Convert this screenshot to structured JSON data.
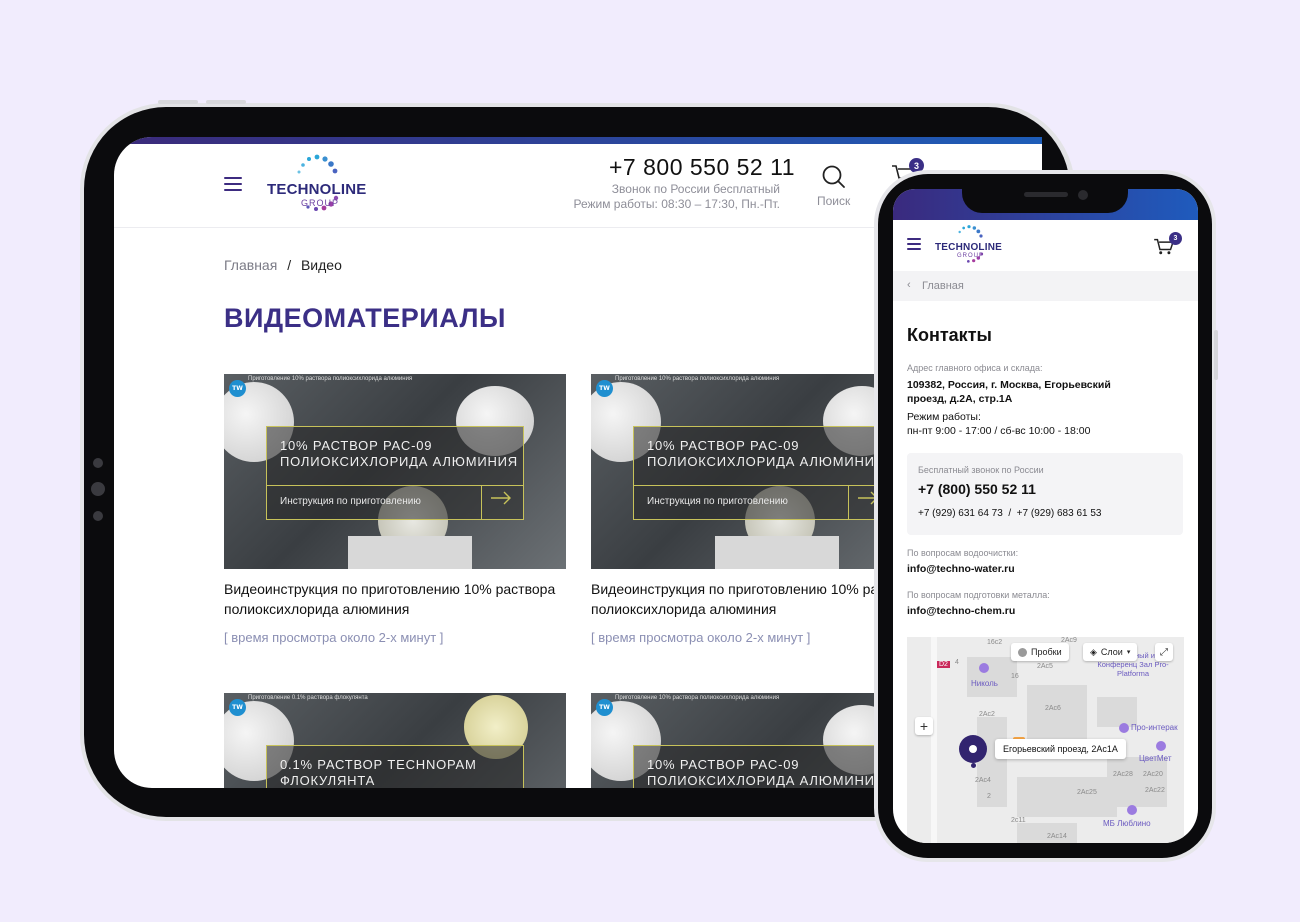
{
  "tablet": {
    "header": {
      "logo": "TECHNOLINE",
      "logo_sub": "GROUP",
      "phone": "+7 800 550 52 11",
      "call_note": "Звонок по России бесплатный",
      "hours": "Режим работы: 08:30 – 17:30, Пн.-Пт.",
      "search_label": "Поиск",
      "cart_count": "3"
    },
    "breadcrumb": {
      "home": "Главная",
      "separator": "/",
      "current": "Видео"
    },
    "page_title": "ВИДЕОМАТЕРИАЛЫ",
    "videos": [
      {
        "overlay_line1": "10% РАСТВОР PAC-09",
        "overlay_line2": "ПОЛИОКСИХЛОРИДА АЛЮМИНИЯ",
        "overlay_sub": "Инструкция по приготовлению",
        "top_caption": "Приготовление 10% раствора полиоксихлорида алюминия",
        "title": "Видеоинструкция по приготовлению 10% раствора полиоксихлорида алюминия",
        "duration": "[ время просмотра около 2-х минут ]"
      },
      {
        "overlay_line1": "10% РАСТВОР PAC-09",
        "overlay_line2": "ПОЛИОКСИХЛОРИДА АЛЮМИНИЯ",
        "overlay_sub": "Инструкция по приготовлению",
        "top_caption": "Приготовление 10% раствора полиоксихлорида алюминия",
        "title": "Видеоинструкция по приготовлению 10% раствора полиоксихлорида алюминия",
        "duration": "[ время просмотра около 2-х минут ]"
      },
      {
        "overlay_line1": "0.1% РАСТВОР TECHNOPAM",
        "overlay_line2": "ФЛОКУЛЯНТА",
        "top_caption": "Приготовление 0.1% раствора флокулянта"
      },
      {
        "overlay_line1": "10% РАСТВОР PAC-09",
        "overlay_line2": "ПОЛИОКСИХЛОРИДА АЛЮМИНИЯ",
        "top_caption": "Приготовление 10% раствора полиоксихлорида алюминия"
      }
    ]
  },
  "phone": {
    "header": {
      "logo": "TECHNOLINE",
      "logo_sub": "GROUP",
      "cart_count": "3"
    },
    "breadcrumb_back": "Главная",
    "title": "Контакты",
    "address_label": "Адрес главного офиса и склада:",
    "address_line1": "109382, Россия, г. Москва, Егорьевский",
    "address_line2": "проезд, д.2А, стр.1А",
    "hours_label": "Режим работы:",
    "hours_value": "пн-пт 9:00 - 17:00 / сб-вс 10:00 - 18:00",
    "free_call_label": "Бесплатный звонок по России",
    "free_call_phone": "+7 (800) 550 52 11",
    "other_phones": "+7 (929) 631 64 73  /  +7 (929) 683 61 53",
    "water_label": "По вопросам водоочистки:",
    "water_email": "info@techno-water.ru",
    "metal_label": "По вопросам подготовки металла:",
    "metal_email": "info@techno-chem.ru",
    "map": {
      "traffic_btn": "Пробки",
      "layers_btn": "Слои",
      "zoom_in": "+",
      "pin_label": "Егорьевский проезд, 2Ас1А",
      "poi": [
        "Николь",
        "Банкетный и Конференц Зал Pro-Platforma",
        "Про-интерак",
        "ЦветМет",
        "МБ Люблино"
      ],
      "buildings": [
        "16с2",
        "2Ас9",
        "2Ас5",
        "16",
        "2Ас2",
        "2Ас6",
        "2Ас28",
        "2Ас20",
        "2Ас22",
        "2Ас25",
        "2Ас4",
        "2с11",
        "2Ас14",
        "4",
        "2"
      ],
      "road": "D2"
    }
  }
}
